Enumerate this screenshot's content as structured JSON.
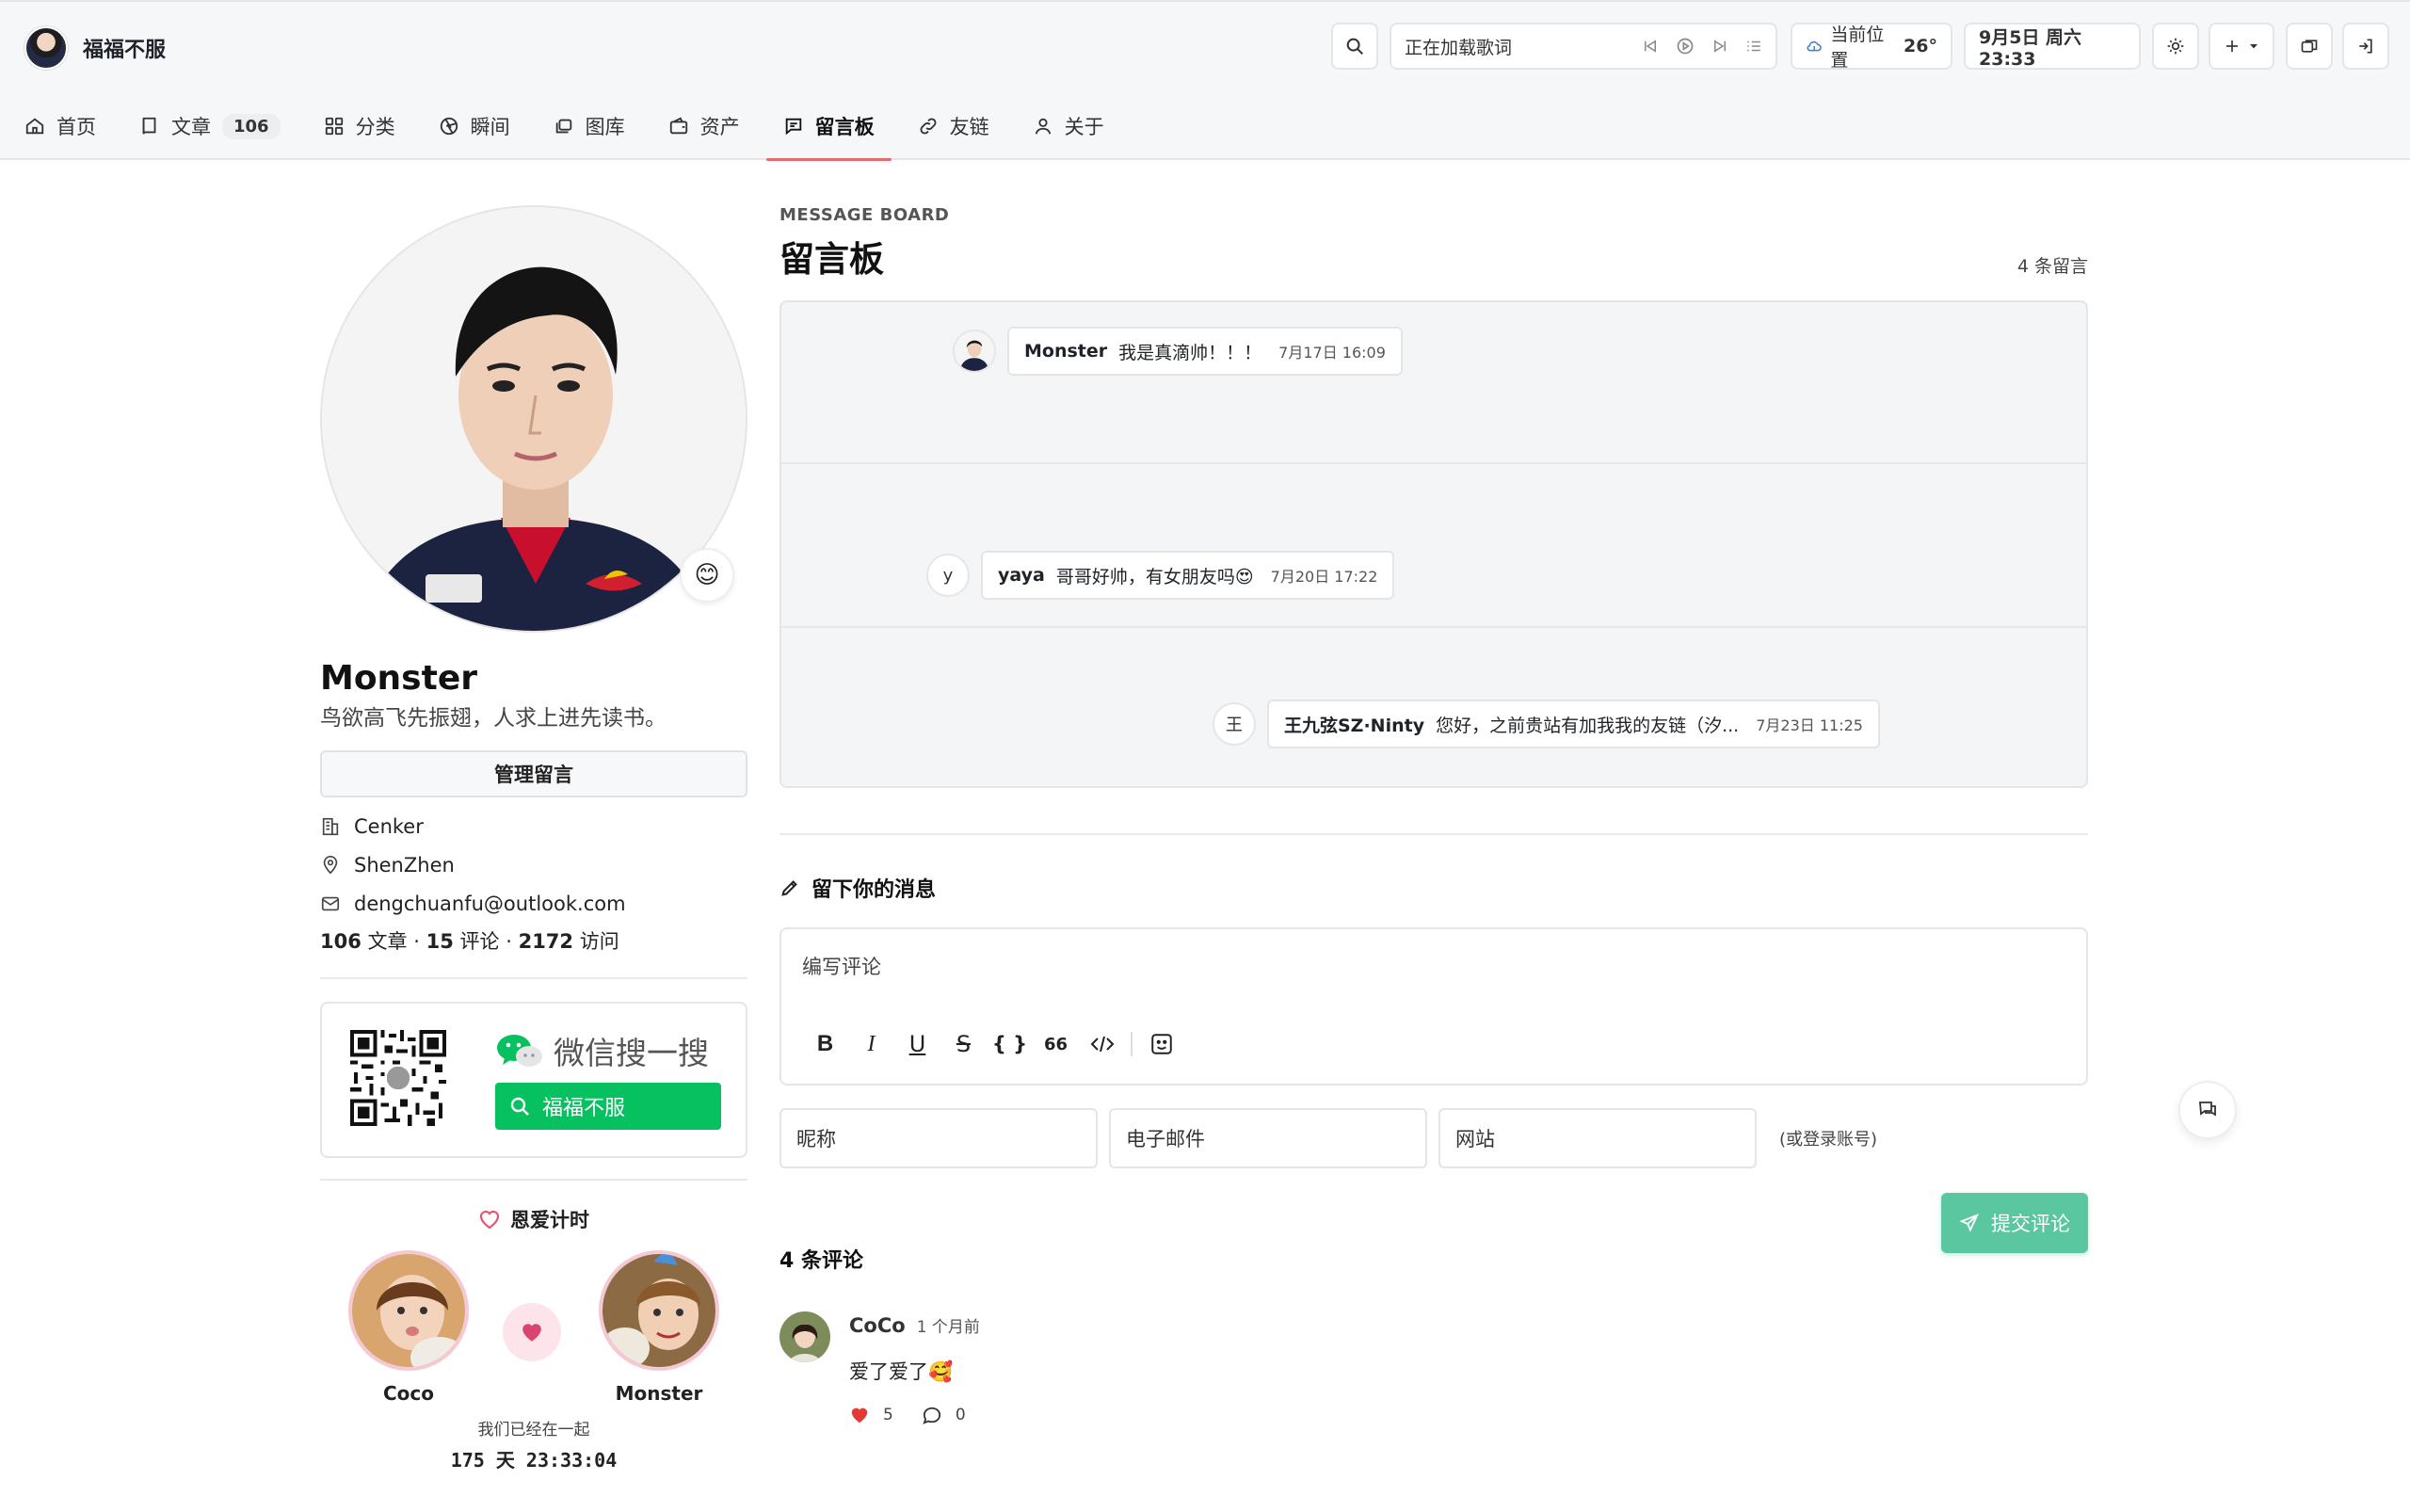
{
  "header": {
    "site_name": "福福不服",
    "lyric_text": "正在加载歌词",
    "weather_label": "当前位置",
    "weather_temp": "26°",
    "datetime": "9月5日 周六 23:33"
  },
  "nav": {
    "home": "首页",
    "articles": "文章",
    "articles_count": "106",
    "categories": "分类",
    "moments": "瞬间",
    "gallery": "图库",
    "assets": "资产",
    "guestbook": "留言板",
    "links": "友链",
    "about": "关于"
  },
  "profile": {
    "emoji": "😊",
    "name": "Monster",
    "bio": "鸟欲高飞先振翅，人求上进先读书。",
    "manage_label": "管理留言",
    "company": "Cenker",
    "location": "ShenZhen",
    "email": "dengchuanfu@outlook.com",
    "articles_num": "106",
    "articles_label": "文章",
    "comments_num": "15",
    "comments_label": "评论",
    "visits_num": "2172",
    "visits_label": "访问",
    "sep": "·"
  },
  "wechat": {
    "title": "微信搜一搜",
    "search_text": "福福不服"
  },
  "love": {
    "title": "恩爱计时",
    "left_name": "Coco",
    "right_name": "Monster",
    "together_label": "我们已经在一起",
    "timer": "175 天 23:33:04"
  },
  "board": {
    "kicker": "MESSAGE BOARD",
    "title": "留言板",
    "count_label": "4 条留言",
    "bullets": [
      {
        "avatar": "",
        "nick": "Monster",
        "text": "我是真滴帅！！！",
        "time": "7月17日 16:09"
      },
      {
        "avatar": "y",
        "nick": "yaya",
        "text": "哥哥好帅，有女朋友吗😍",
        "time": "7月20日 17:22"
      },
      {
        "avatar": "王",
        "nick": "王九弦SZ·Ninty",
        "text": "您好，之前贵站有加我我的友链（汐...",
        "time": "7月23日 11:25"
      }
    ]
  },
  "form": {
    "section_title": "留下你的消息",
    "editor_placeholder": "编写评论",
    "toolbar": {
      "bold": "B",
      "italic": "I",
      "underline": "U",
      "strike": "S",
      "code": "{ }",
      "quote": "66"
    },
    "nickname_ph": "昵称",
    "email_ph": "电子邮件",
    "website_ph": "网站",
    "login_hint": "(或登录账号)",
    "submit_label": "提交评论"
  },
  "comments": {
    "count_label": "4 条评论",
    "items": [
      {
        "nick": "CoCo",
        "time": "1 个月前",
        "body": "爱了爱了🥰",
        "likes": "5",
        "replies": "0"
      }
    ]
  },
  "colors": {
    "accent_tab": "#e66a72",
    "submit_green": "#5ac7a0",
    "wechat_green": "#07c160",
    "like_red": "#e53935"
  }
}
